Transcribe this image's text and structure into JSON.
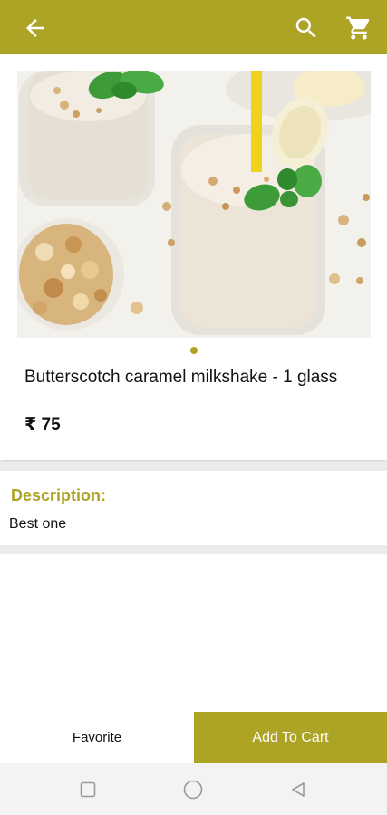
{
  "header": {
    "back_icon": "arrow-left-icon",
    "search_icon": "search-icon",
    "cart_icon": "shopping-cart-icon",
    "color": "#ada325"
  },
  "product": {
    "image": "butterscotch-milkshake-photo",
    "name": "Butterscotch caramel milkshake - 1 glass",
    "price": "₹ 75",
    "carousel_pages": 1,
    "carousel_active": 1
  },
  "description": {
    "title": "Description:",
    "text": "Best one"
  },
  "actions": {
    "favorite_label": "Favorite",
    "add_to_cart_label": "Add To Cart"
  },
  "system_nav": {
    "recent_icon": "square-recents-icon",
    "home_icon": "circle-home-icon",
    "back_icon": "triangle-back-icon"
  },
  "colors": {
    "accent": "#ada325",
    "divider": "#ececec",
    "text": "#111111"
  }
}
